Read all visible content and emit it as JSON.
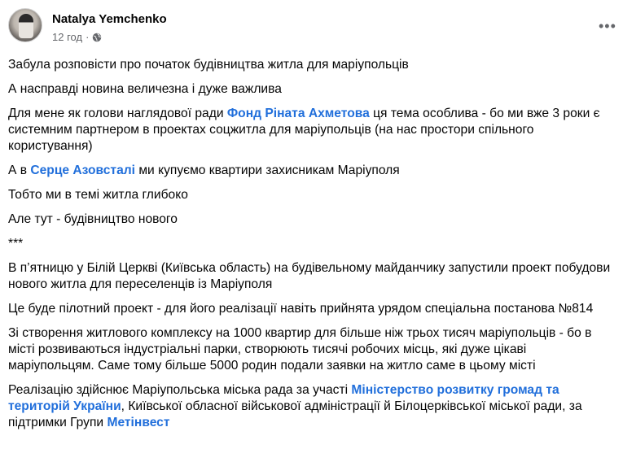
{
  "post": {
    "author": "Natalya Yemchenko",
    "time": "12 год",
    "separator": "·",
    "more_label": "•••",
    "paragraphs": [
      [
        {
          "t": "Забула розповісти про початок будівництва житла  для маріупольців"
        }
      ],
      [
        {
          "t": "А насправді новина величезна і дуже важлива"
        }
      ],
      [
        {
          "t": "Для мене як голови наглядової ради  "
        },
        {
          "t": "Фонд Ріната Ахметова",
          "link": true
        },
        {
          "t": " ця тема  особлива - бо ми вже 3 роки є системним партнером в проектах соцжитла для маріупольців (на нас простори спільного користування)"
        }
      ],
      [
        {
          "t": "А в "
        },
        {
          "t": "Серце Азовсталі",
          "link": true
        },
        {
          "t": " ми купуємо квартири захисникам Маріуполя"
        }
      ],
      [
        {
          "t": "Тобто ми в темі житла глибоко"
        }
      ],
      [
        {
          "t": "Але тут - будівництво нового"
        }
      ],
      [
        {
          "t": "***"
        }
      ],
      [
        {
          "t": "В п’ятницю у Білій Церкві (Київська область) на будівельному майданчику  запустили  проект побудови нового  житла для переселенців із Маріуполя"
        }
      ],
      [
        {
          "t": "Це буде  пілотний проект - для його реалізації навіть прийнята урядом спеціальна постанова №814"
        }
      ],
      [
        {
          "t": "Зі  створення житлового комплексу на 1000 квартир для більше ніж трьох тисяч маріупольців  - бо в місті розвиваються індустріальні парки, створюють тисячі робочих місць, які дуже цікаві маріупольцям. Саме тому більше 5000 родин подали заявки на житло саме в цьому місті"
        }
      ],
      [
        {
          "t": "Реалізацію здійснює Маріупольська міська рада за участі  "
        },
        {
          "t": "Міністерство розвитку громад та територій України",
          "link": true
        },
        {
          "t": ", Київської обласної військової адміністрації й Білоцерківської міської ради, за підтримки Групи "
        },
        {
          "t": "Метінвест",
          "link": true
        }
      ]
    ]
  },
  "colors": {
    "link": "#216fdb",
    "meta": "#65676b",
    "text": "#050505"
  },
  "icons": {
    "privacy": "globe-icon",
    "menu": "more-horizontal-icon"
  }
}
